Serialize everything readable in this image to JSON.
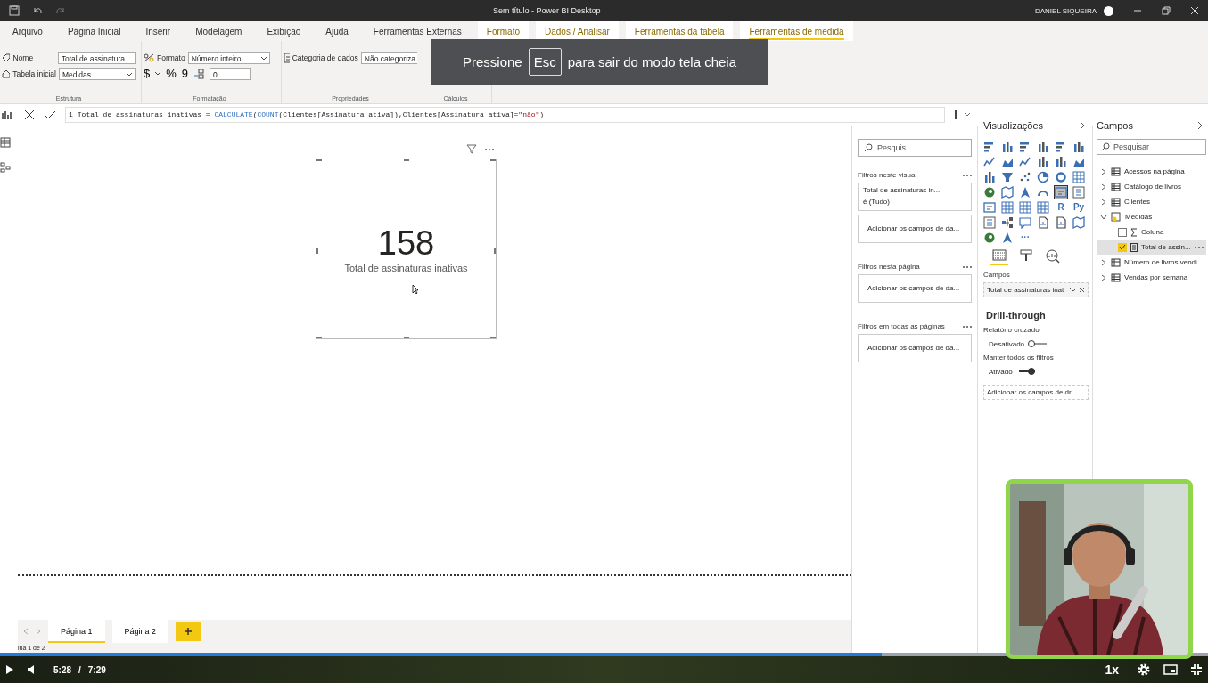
{
  "window": {
    "title": "Sem título - Power BI Desktop",
    "user": "DANIEL SIQUEIRA"
  },
  "ribbon_tabs": [
    {
      "label": "Arquivo",
      "selected": false,
      "contextual": false
    },
    {
      "label": "Página Inicial",
      "selected": false,
      "contextual": false
    },
    {
      "label": "Inserir",
      "selected": false,
      "contextual": false
    },
    {
      "label": "Modelagem",
      "selected": false,
      "contextual": false
    },
    {
      "label": "Exibição",
      "selected": false,
      "contextual": false
    },
    {
      "label": "Ajuda",
      "selected": false,
      "contextual": false
    },
    {
      "label": "Ferramentas Externas",
      "selected": false,
      "contextual": false
    },
    {
      "label": "Formato",
      "selected": false,
      "contextual": true
    },
    {
      "label": "Dados / Analisar",
      "selected": false,
      "contextual": true
    },
    {
      "label": "Ferramentas da tabela",
      "selected": false,
      "contextual": true
    },
    {
      "label": "Ferramentas de medida",
      "selected": true,
      "contextual": true
    }
  ],
  "ribbon": {
    "structure": {
      "caption": "Estrutura",
      "name_label": "Nome",
      "name_value": "Total de assinatura...",
      "table_label": "Tabela inicial",
      "table_value": "Medidas"
    },
    "formatting": {
      "caption": "Formatação",
      "format_label": "Formato",
      "format_value": "Número inteiro",
      "currency": "$",
      "percent": "%",
      "comma": "9",
      "decimals": "0"
    },
    "properties": {
      "caption": "Propriedades",
      "category_label": "Categoria de dados",
      "category_value": "Não categoriza"
    },
    "calculations": {
      "caption": "Cálculos"
    }
  },
  "fullscreen_notice": {
    "before": "Pressione",
    "key": "Esc",
    "after": "para sair do modo tela cheia"
  },
  "formula": {
    "line": "1",
    "tokens": [
      {
        "text": "Total de assinaturas inativas = ",
        "kind": "plain"
      },
      {
        "text": "CALCULATE",
        "kind": "function"
      },
      {
        "text": "(",
        "kind": "plain"
      },
      {
        "text": "COUNT",
        "kind": "function"
      },
      {
        "text": "(Clientes[Assinatura ativa]),Clientes[Assinatura ativa]=",
        "kind": "plain"
      },
      {
        "text": "\"não\"",
        "kind": "string"
      },
      {
        "text": ")",
        "kind": "plain"
      }
    ]
  },
  "card": {
    "value": "158",
    "label": "Total de assinaturas inativas"
  },
  "filters": {
    "search_placeholder": "Pesquis...",
    "sections": [
      {
        "title": "Filtros neste visual",
        "items": [
          {
            "kind": "filter",
            "name": "Total de assinaturas in...",
            "condition": "é (Tudo)"
          },
          {
            "kind": "drop",
            "text": "Adicionar os campos de da..."
          }
        ]
      },
      {
        "title": "Filtros nesta página",
        "items": [
          {
            "kind": "drop",
            "text": "Adicionar os campos de da..."
          }
        ]
      },
      {
        "title": "Filtros em todas as páginas",
        "items": [
          {
            "kind": "drop",
            "text": "Adicionar os campos de da..."
          }
        ]
      }
    ]
  },
  "visualizations": {
    "title": "Visualizações",
    "icons": [
      {
        "kind": "bar",
        "selected": false
      },
      {
        "kind": "column",
        "selected": false
      },
      {
        "kind": "bar",
        "selected": false
      },
      {
        "kind": "column",
        "selected": false
      },
      {
        "kind": "bar",
        "selected": false
      },
      {
        "kind": "column",
        "selected": false
      },
      {
        "kind": "line",
        "selected": false
      },
      {
        "kind": "area",
        "selected": false
      },
      {
        "kind": "line",
        "selected": false
      },
      {
        "kind": "column",
        "selected": false
      },
      {
        "kind": "column",
        "selected": false
      },
      {
        "kind": "area",
        "selected": false
      },
      {
        "kind": "column",
        "selected": false
      },
      {
        "kind": "funnel",
        "selected": false
      },
      {
        "kind": "scatter",
        "selected": false
      },
      {
        "kind": "pie",
        "selected": false
      },
      {
        "kind": "donut",
        "selected": false
      },
      {
        "kind": "table",
        "selected": false
      },
      {
        "kind": "globe",
        "selected": false
      },
      {
        "kind": "map",
        "selected": false
      },
      {
        "kind": "arrow",
        "selected": false
      },
      {
        "kind": "gauge",
        "selected": false
      },
      {
        "kind": "card",
        "selected": true
      },
      {
        "kind": "list",
        "selected": false
      },
      {
        "kind": "card",
        "selected": false
      },
      {
        "kind": "table",
        "selected": false
      },
      {
        "kind": "table",
        "selected": false
      },
      {
        "kind": "table",
        "selected": false
      },
      {
        "kind": "glyph",
        "text": "R",
        "selected": false
      },
      {
        "kind": "glyph",
        "text": "Py",
        "selected": false
      },
      {
        "kind": "list",
        "selected": false
      },
      {
        "kind": "tree",
        "selected": false
      },
      {
        "kind": "bubble",
        "selected": false
      },
      {
        "kind": "page",
        "selected": false
      },
      {
        "kind": "page",
        "selected": false
      },
      {
        "kind": "map",
        "selected": false
      },
      {
        "kind": "globe",
        "selected": false
      },
      {
        "kind": "arrow",
        "selected": false
      },
      {
        "kind": "glyph",
        "text": "···",
        "selected": false
      }
    ],
    "pane_tabs": [
      {
        "kind": "fields",
        "selected": true
      },
      {
        "kind": "format",
        "selected": false
      },
      {
        "kind": "analytics",
        "selected": false
      }
    ],
    "well_label": "Campos",
    "well_value": "Total de assinaturas inat",
    "drill_title": "Drill-through",
    "toggles": [
      {
        "label": "Relatório cruzado",
        "state": "Desativado",
        "on": false
      },
      {
        "label": "Manter todos os filtros",
        "state": "Ativado",
        "on": true
      }
    ],
    "drill_drop": "Adicionar os campos de dr..."
  },
  "fields": {
    "title": "Campos",
    "search_placeholder": "Pesquisar",
    "tables": [
      {
        "name": "Acessos na página",
        "kind": "table",
        "expanded": false
      },
      {
        "name": "Catálogo de livros",
        "kind": "table",
        "expanded": false
      },
      {
        "name": "Clientes",
        "kind": "table",
        "expanded": false
      },
      {
        "name": "Medidas",
        "kind": "measures",
        "expanded": true,
        "children": [
          {
            "name": "Coluna",
            "kind": "column",
            "checked": false,
            "selected": false
          },
          {
            "name": "Total de assin...",
            "kind": "measure",
            "checked": true,
            "selected": true
          }
        ]
      },
      {
        "name": "Número de livros vendi...",
        "kind": "table",
        "expanded": false
      },
      {
        "name": "Vendas por semana",
        "kind": "table",
        "expanded": false
      }
    ]
  },
  "pages": [
    {
      "label": "Página 1",
      "selected": true
    },
    {
      "label": "Página 2",
      "selected": false
    }
  ],
  "status": "ina 1 de 2",
  "video": {
    "level": 0.73,
    "time": "5:28",
    "separator": "/",
    "duration": "7:29",
    "speed": "1x"
  }
}
